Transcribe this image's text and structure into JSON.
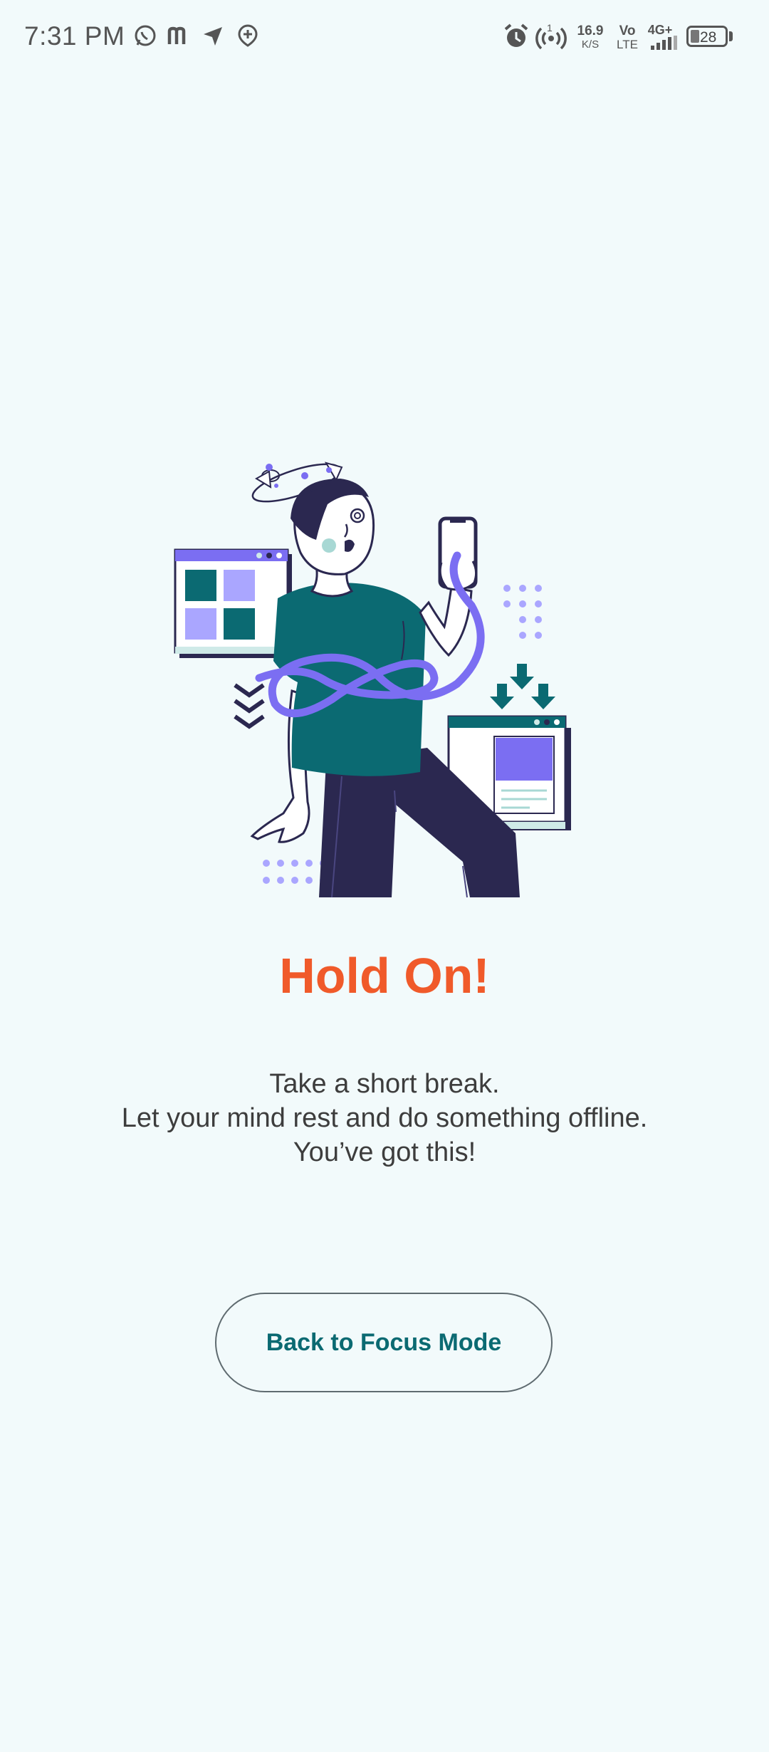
{
  "status_bar": {
    "time": "7:31 PM",
    "net_speed_value": "16.9",
    "net_speed_unit": "K/S",
    "volte_top": "Vo",
    "volte_bottom": "LTE",
    "network": "4G+",
    "battery": "28",
    "hotspot_count": "1",
    "icons": [
      "whatsapp-icon",
      "m-app-icon",
      "send-icon",
      "location-add-icon",
      "alarm-icon",
      "hotspot-icon",
      "signal-icon",
      "battery-icon"
    ]
  },
  "main": {
    "title": "Hold On!",
    "message_lines": [
      "Take a short break.",
      "Let your mind rest and do something offline.",
      "You’ve got this!"
    ],
    "back_button_label": "Back to Focus Mode"
  },
  "colors": {
    "background": "#f2fafb",
    "title": "#f05a2a",
    "button_text": "#0b6a72",
    "teal": "#0b6a72",
    "purple": "#7b6ef2",
    "navy": "#2b2850"
  }
}
